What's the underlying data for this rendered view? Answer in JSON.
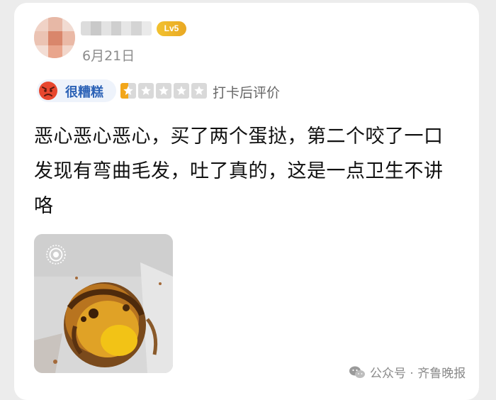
{
  "user": {
    "level_badge": "Lv5",
    "post_date": "6月21日"
  },
  "rating": {
    "label": "很糟糕",
    "stars_filled": 0.5,
    "stars_total": 5,
    "checkin_label": "打卡后评价",
    "colors": {
      "label": "#2d63b7",
      "star_filled": "#f2a61a",
      "star_empty": "#d9d9d9",
      "icon": "#e8472f"
    }
  },
  "review": {
    "lines": [
      "恶心恶心恶心，买了两个蛋挞，第二个咬了一口",
      "发现有弯曲毛发，吐了真的，这是一点卫生不讲",
      "咯"
    ]
  },
  "photo": {
    "live_icon": "live-photo-icon"
  },
  "watermark": {
    "text": "公众号 · 齐鲁晚报",
    "icon": "wechat-icon"
  }
}
